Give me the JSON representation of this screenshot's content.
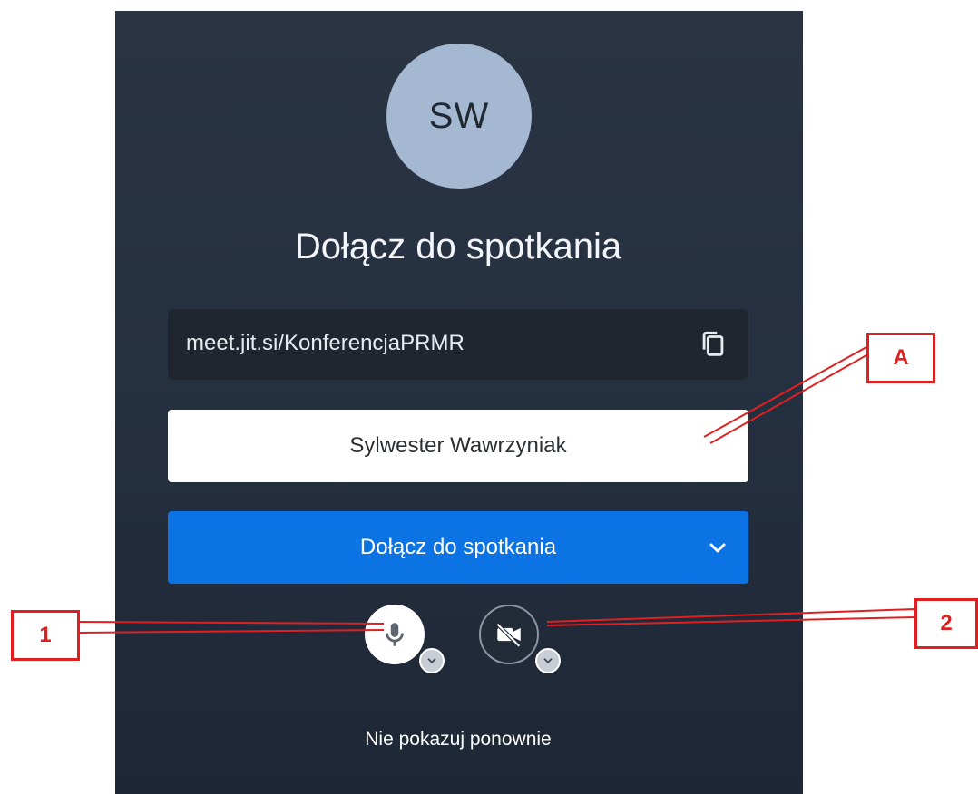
{
  "header_fragment": "„ ... ... ... ... ... ... ... ... ... ... ... ... ... ... ... ... ... ... ... ... ... ... ... ... ... ... ... ... ... ... ... ... ...",
  "avatar": {
    "initials": "SW",
    "color": "#a4b8d1"
  },
  "title": "Dołącz do spotkania",
  "meeting": {
    "url": "meet.jit.si/KonferencjaPRMR",
    "copy_icon": "copy-icon"
  },
  "name_field": {
    "value": "Sylwester Wawrzyniak",
    "placeholder": ""
  },
  "join_button": {
    "label": "Dołącz do spotkania",
    "icon": "chevron-down-icon",
    "color": "#0b73e3"
  },
  "controls": {
    "mic": {
      "icon": "microphone-icon",
      "state": "on"
    },
    "camera": {
      "icon": "camera-off-icon",
      "state": "off"
    }
  },
  "dont_show_again": "Nie pokazuj ponownie",
  "annotations": {
    "a": "A",
    "one": "1",
    "two": "2",
    "color": "#e02020"
  }
}
